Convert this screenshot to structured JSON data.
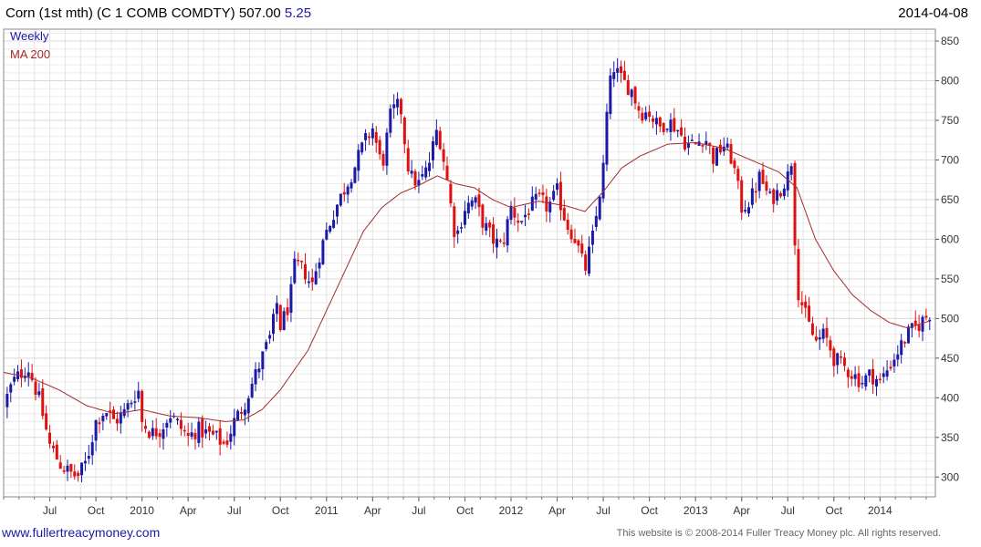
{
  "header": {
    "title_prefix": "Corn (1st mth) (C 1 COMB COMDTY) 507.00",
    "change": "5.25",
    "date": "2014-04-08"
  },
  "footer": {
    "site": "www.fullertreacymoney.com",
    "copyright": "This website is © 2008-2014 Fuller Treacy Money plc. All rights reserved."
  },
  "colors": {
    "up": "#1a1aa6",
    "down": "#dd1111",
    "ma": "#a52a2a",
    "grid": "#d9d9d9"
  },
  "chart_data": {
    "type": "candlestick",
    "legend": [
      "Weekly",
      "MA 200"
    ],
    "legend_position": "top-left",
    "y_axis_position": "right",
    "grid": true,
    "ylim": [
      275,
      660
    ],
    "yticks": [
      300,
      350,
      400,
      450,
      500,
      550,
      600,
      650,
      700,
      750,
      800,
      850
    ],
    "xlim": [
      2009.25,
      2014.3
    ],
    "xticks": [
      {
        "label": "Jul",
        "x": 2009.5
      },
      {
        "label": "Oct",
        "x": 2009.75
      },
      {
        "label": "2010",
        "x": 2010.0
      },
      {
        "label": "Apr",
        "x": 2010.25
      },
      {
        "label": "Jul",
        "x": 2010.5
      },
      {
        "label": "Oct",
        "x": 2010.75
      },
      {
        "label": "2011",
        "x": 2011.0
      },
      {
        "label": "Apr",
        "x": 2011.25
      },
      {
        "label": "Jul",
        "x": 2011.5
      },
      {
        "label": "Oct",
        "x": 2011.75
      },
      {
        "label": "2012",
        "x": 2012.0
      },
      {
        "label": "Apr",
        "x": 2012.25
      },
      {
        "label": "Jul",
        "x": 2012.5
      },
      {
        "label": "Oct",
        "x": 2012.75
      },
      {
        "label": "2013",
        "x": 2013.0
      },
      {
        "label": "Apr",
        "x": 2013.25
      },
      {
        "label": "Jul",
        "x": 2013.5
      },
      {
        "label": "Oct",
        "x": 2013.75
      },
      {
        "label": "2014",
        "x": 2014.0
      }
    ],
    "close_anchors": [
      [
        2009.25,
        390
      ],
      [
        2009.3,
        420
      ],
      [
        2009.38,
        440
      ],
      [
        2009.44,
        400
      ],
      [
        2009.5,
        340
      ],
      [
        2009.56,
        315
      ],
      [
        2009.61,
        305
      ],
      [
        2009.65,
        300
      ],
      [
        2009.7,
        320
      ],
      [
        2009.75,
        370
      ],
      [
        2009.8,
        385
      ],
      [
        2009.85,
        370
      ],
      [
        2009.9,
        380
      ],
      [
        2009.95,
        400
      ],
      [
        2009.98,
        410
      ],
      [
        2010.0,
        370
      ],
      [
        2010.05,
        355
      ],
      [
        2010.1,
        360
      ],
      [
        2010.15,
        380
      ],
      [
        2010.2,
        365
      ],
      [
        2010.25,
        350
      ],
      [
        2010.3,
        360
      ],
      [
        2010.35,
        355
      ],
      [
        2010.4,
        350
      ],
      [
        2010.45,
        340
      ],
      [
        2010.5,
        370
      ],
      [
        2010.55,
        390
      ],
      [
        2010.6,
        420
      ],
      [
        2010.65,
        450
      ],
      [
        2010.7,
        480
      ],
      [
        2010.73,
        520
      ],
      [
        2010.75,
        490
      ],
      [
        2010.8,
        520
      ],
      [
        2010.83,
        570
      ],
      [
        2010.88,
        560
      ],
      [
        2010.92,
        540
      ],
      [
        2010.96,
        580
      ],
      [
        2011.0,
        610
      ],
      [
        2011.05,
        640
      ],
      [
        2011.1,
        665
      ],
      [
        2011.15,
        690
      ],
      [
        2011.2,
        720
      ],
      [
        2011.25,
        740
      ],
      [
        2011.3,
        690
      ],
      [
        2011.35,
        760
      ],
      [
        2011.4,
        770
      ],
      [
        2011.42,
        730
      ],
      [
        2011.45,
        680
      ],
      [
        2011.5,
        670
      ],
      [
        2011.55,
        690
      ],
      [
        2011.6,
        740
      ],
      [
        2011.62,
        720
      ],
      [
        2011.65,
        680
      ],
      [
        2011.7,
        600
      ],
      [
        2011.75,
        640
      ],
      [
        2011.8,
        650
      ],
      [
        2011.85,
        620
      ],
      [
        2011.9,
        600
      ],
      [
        2011.95,
        590
      ],
      [
        2012.0,
        640
      ],
      [
        2012.05,
        620
      ],
      [
        2012.1,
        640
      ],
      [
        2012.15,
        650
      ],
      [
        2012.2,
        640
      ],
      [
        2012.25,
        660
      ],
      [
        2012.3,
        620
      ],
      [
        2012.35,
        600
      ],
      [
        2012.4,
        560
      ],
      [
        2012.45,
        610
      ],
      [
        2012.5,
        690
      ],
      [
        2012.52,
        760
      ],
      [
        2012.55,
        820
      ],
      [
        2012.6,
        800
      ],
      [
        2012.65,
        790
      ],
      [
        2012.7,
        760
      ],
      [
        2012.75,
        760
      ],
      [
        2012.8,
        740
      ],
      [
        2012.85,
        750
      ],
      [
        2012.9,
        740
      ],
      [
        2012.95,
        720
      ],
      [
        2013.0,
        720
      ],
      [
        2013.05,
        730
      ],
      [
        2013.1,
        700
      ],
      [
        2013.15,
        720
      ],
      [
        2013.2,
        700
      ],
      [
        2013.25,
        640
      ],
      [
        2013.3,
        650
      ],
      [
        2013.35,
        680
      ],
      [
        2013.4,
        650
      ],
      [
        2013.45,
        660
      ],
      [
        2013.5,
        680
      ],
      [
        2013.52,
        700
      ],
      [
        2013.55,
        540
      ],
      [
        2013.6,
        500
      ],
      [
        2013.65,
        470
      ],
      [
        2013.7,
        480
      ],
      [
        2013.75,
        450
      ],
      [
        2013.8,
        440
      ],
      [
        2013.85,
        430
      ],
      [
        2013.9,
        420
      ],
      [
        2013.95,
        430
      ],
      [
        2014.0,
        420
      ],
      [
        2014.05,
        440
      ],
      [
        2014.1,
        460
      ],
      [
        2014.15,
        480
      ],
      [
        2014.2,
        490
      ],
      [
        2014.27,
        507
      ]
    ],
    "ma200_anchors": [
      [
        2009.25,
        432
      ],
      [
        2009.4,
        425
      ],
      [
        2009.55,
        410
      ],
      [
        2009.7,
        390
      ],
      [
        2009.85,
        380
      ],
      [
        2010.0,
        385
      ],
      [
        2010.15,
        377
      ],
      [
        2010.3,
        375
      ],
      [
        2010.45,
        370
      ],
      [
        2010.55,
        372
      ],
      [
        2010.65,
        385
      ],
      [
        2010.75,
        410
      ],
      [
        2010.9,
        460
      ],
      [
        2011.0,
        510
      ],
      [
        2011.1,
        560
      ],
      [
        2011.2,
        610
      ],
      [
        2011.3,
        640
      ],
      [
        2011.4,
        658
      ],
      [
        2011.5,
        668
      ],
      [
        2011.6,
        680
      ],
      [
        2011.7,
        670
      ],
      [
        2011.8,
        665
      ],
      [
        2011.9,
        650
      ],
      [
        2012.0,
        640
      ],
      [
        2012.15,
        648
      ],
      [
        2012.3,
        642
      ],
      [
        2012.4,
        635
      ],
      [
        2012.5,
        660
      ],
      [
        2012.6,
        690
      ],
      [
        2012.7,
        705
      ],
      [
        2012.85,
        720
      ],
      [
        2013.0,
        722
      ],
      [
        2013.15,
        715
      ],
      [
        2013.3,
        700
      ],
      [
        2013.45,
        685
      ],
      [
        2013.55,
        665
      ],
      [
        2013.65,
        600
      ],
      [
        2013.75,
        560
      ],
      [
        2013.85,
        530
      ],
      [
        2013.95,
        510
      ],
      [
        2014.05,
        495
      ],
      [
        2014.15,
        488
      ],
      [
        2014.27,
        497
      ]
    ]
  }
}
